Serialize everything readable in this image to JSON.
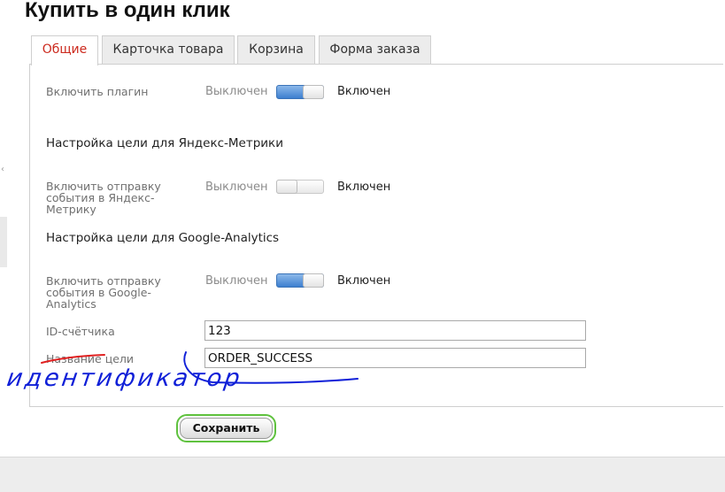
{
  "page": {
    "title": "Купить в один клик"
  },
  "tabs": [
    {
      "label": "Общие",
      "active": true
    },
    {
      "label": "Карточка товара",
      "active": false
    },
    {
      "label": "Корзина",
      "active": false
    },
    {
      "label": "Форма заказа",
      "active": false
    }
  ],
  "settings": {
    "plugin": {
      "label": "Включить плагин",
      "off": "Выключен",
      "on": "Включен",
      "state": "on"
    },
    "yandex_section": {
      "title": "Настройка цели для Яндекс-Метрики"
    },
    "yandex": {
      "label": "Включить отправку события в Яндекс-Метрику",
      "off": "Выключен",
      "on": "Включен",
      "state": "off"
    },
    "ga_section": {
      "title": "Настройка цели для Google-Analytics"
    },
    "ga": {
      "label": "Включить отправку события в Google-Analytics",
      "off": "Выключен",
      "on": "Включен",
      "state": "on"
    },
    "counter_id": {
      "label": "ID-счётчика",
      "value": "123"
    },
    "goal_name": {
      "label": "Название цели",
      "value": "ORDER_SUCCESS"
    }
  },
  "actions": {
    "save_label": "Сохранить"
  },
  "annotation": {
    "handwritten_text": "идентификатор",
    "color": "#1020d8",
    "underline_color": "#e02020"
  },
  "colors": {
    "active_tab": "#cc2a1e",
    "toggle_on": "#3d7fcf",
    "save_border": "#5fc23e"
  }
}
